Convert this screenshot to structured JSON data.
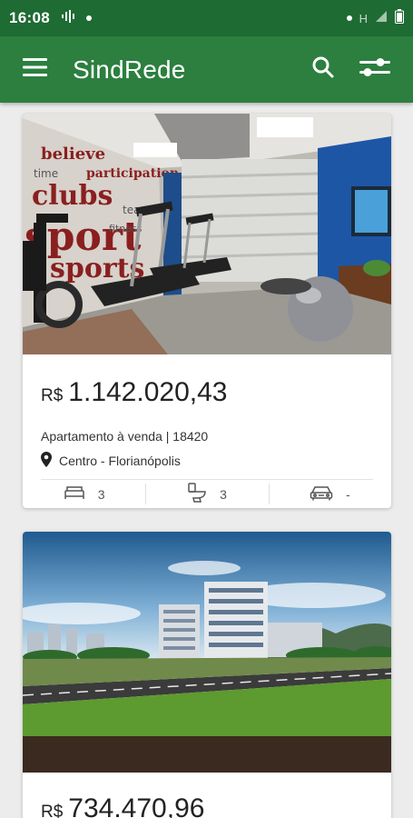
{
  "status_bar": {
    "time": "16:08",
    "network_label": "H"
  },
  "app_bar": {
    "title": "SindRede",
    "icons": [
      "menu-icon",
      "search-icon",
      "filter-icon"
    ]
  },
  "colors": {
    "status_bar": "#1f6b34",
    "app_bar": "#2c7f3f",
    "background": "#ececec"
  },
  "listings": [
    {
      "currency": "R$",
      "price": "1.142.020,43",
      "description": "Apartamento à venda | 18420",
      "location": "Centro - Florianópolis",
      "bedrooms": "3",
      "bathrooms": "3",
      "parking": "-",
      "photo": "gym-photo"
    },
    {
      "currency": "R$",
      "price": "734.470,96",
      "photo": "building-exterior-photo"
    }
  ]
}
